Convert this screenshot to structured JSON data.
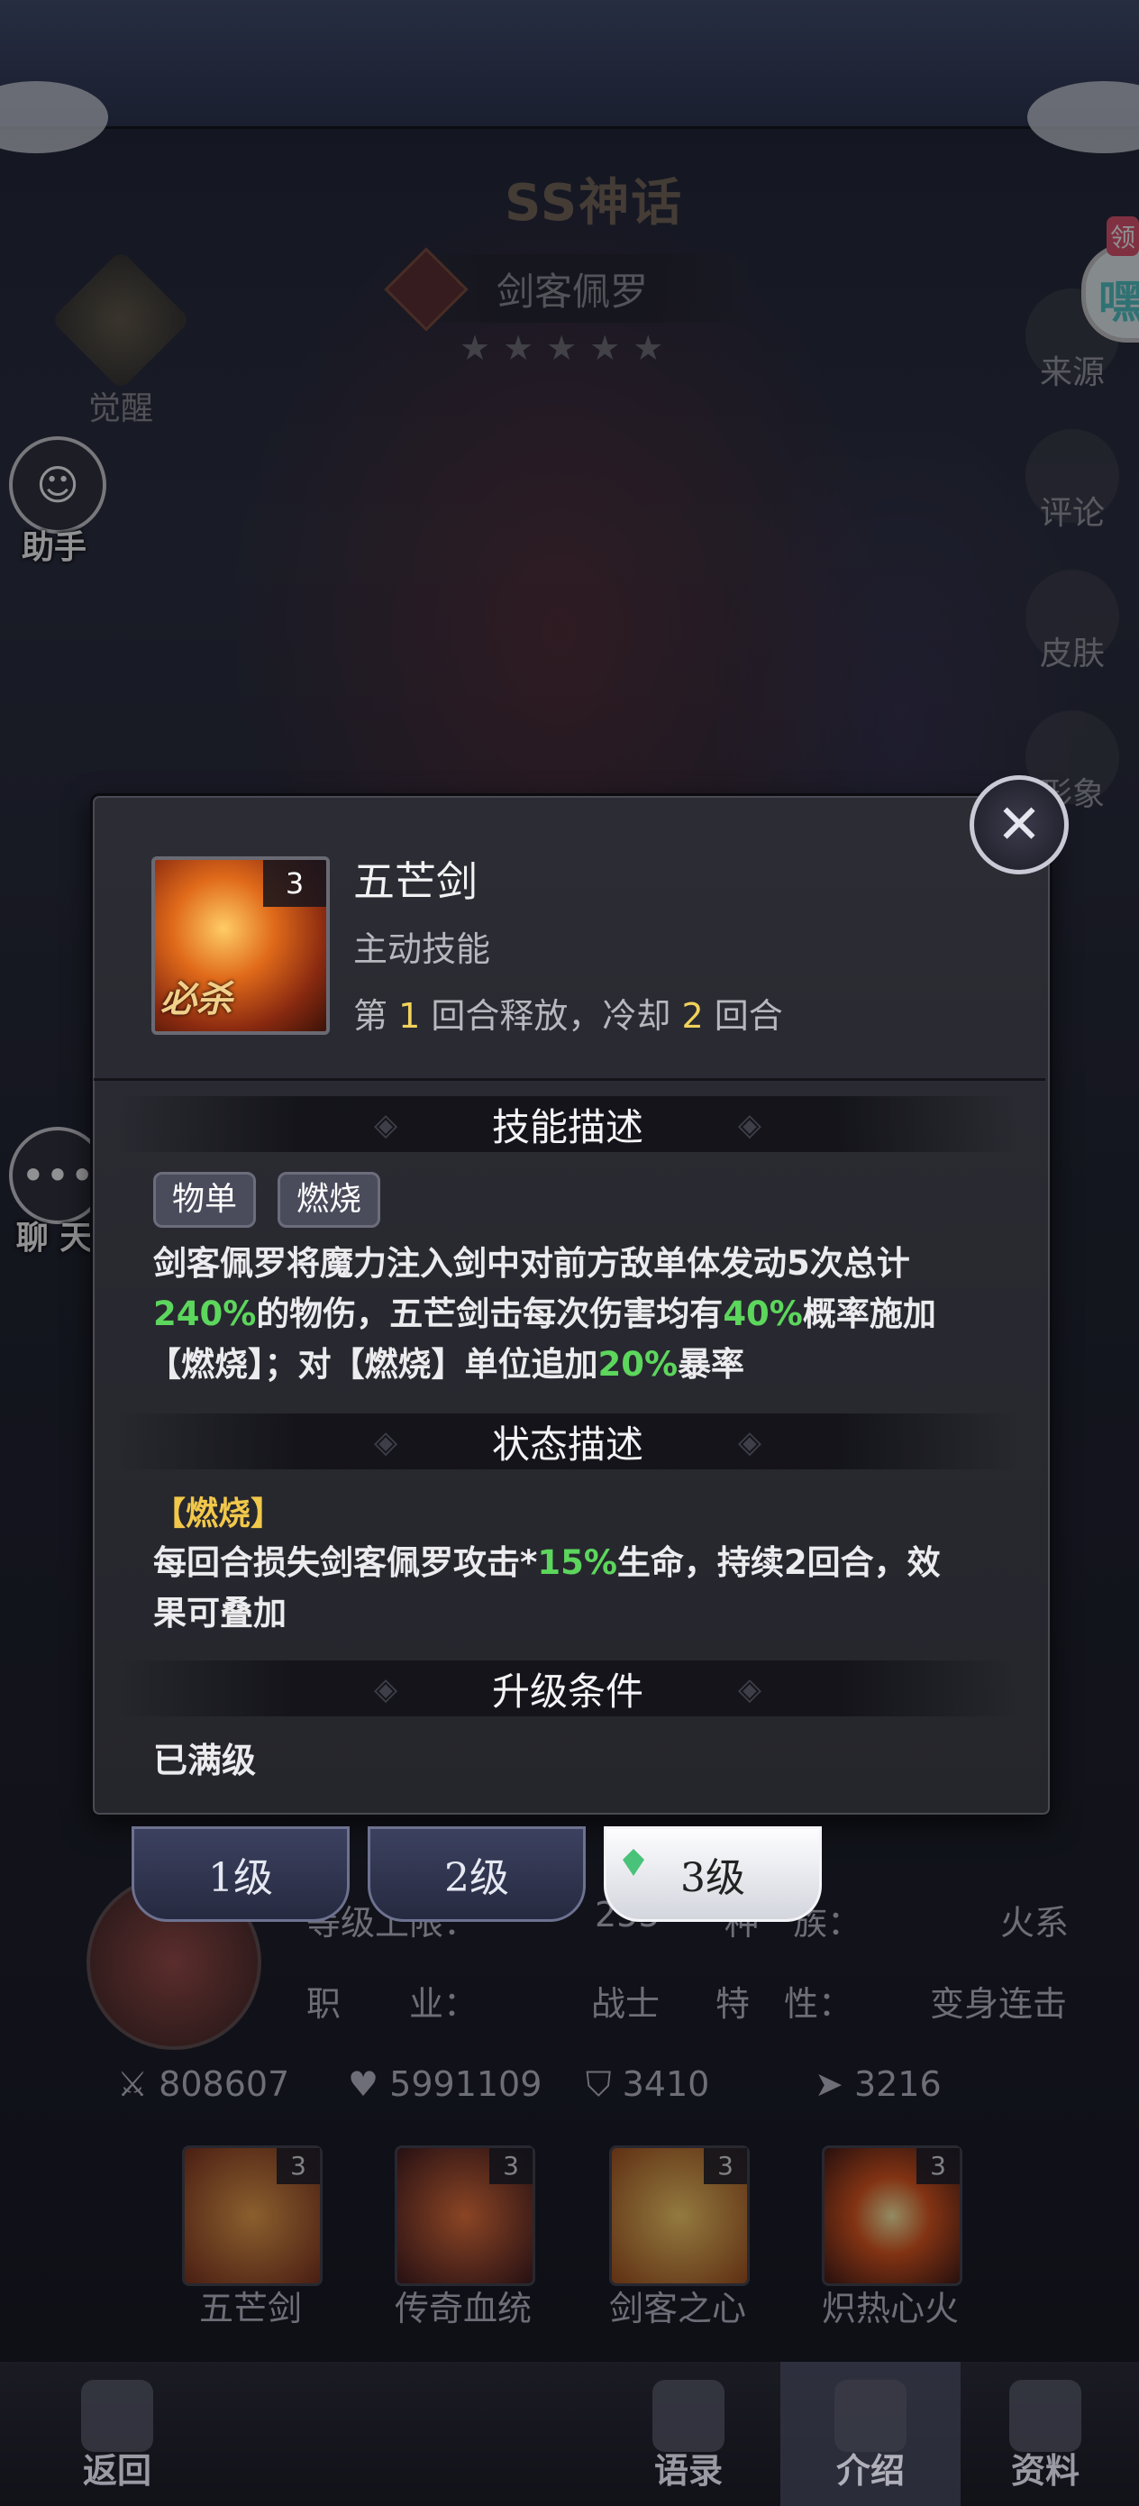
{
  "hero": {
    "rarity": "SS神话",
    "name": "剑客佩罗",
    "stars": "★★★★★",
    "awaken_label": "觉醒"
  },
  "left_buttons": {
    "assistant": "助手",
    "chat": "聊 天"
  },
  "right_buttons": {
    "source": "来源",
    "comment": "评论",
    "skin": "皮肤",
    "image": "形象",
    "bubble_tag": "领",
    "bubble_text": "嘿"
  },
  "dialog": {
    "close_symbol": "✕",
    "skill_icon_level": "3",
    "skill_icon_tag": "必杀",
    "skill_name": "五芒剑",
    "skill_type": "主动技能",
    "cooldown": {
      "p1": "第 ",
      "n1": "1",
      "p2": " 回合释放，冷却 ",
      "n2": "2",
      "p3": " 回合"
    },
    "section_desc": "技能描述",
    "tags": [
      "物单",
      "燃烧"
    ],
    "desc": {
      "line1": "剑客佩罗将魔力注入剑中对前方敌单体发动5次总计",
      "v1": "240%",
      "t2": "的物伤，五芒剑击每次伤害均有",
      "v2": "40%",
      "t3": "概率施加",
      "t4": "【燃烧】；对【燃烧】单位追加",
      "v3": "20%",
      "t5": "暴率"
    },
    "section_state": "状态描述",
    "burn_title": "【燃烧】",
    "state": {
      "t1": "每回合损失剑客佩罗攻击*",
      "v1": "15%",
      "t2": "生命，持续2回合，效",
      "t3": "果可叠加"
    },
    "section_upgrade": "升级条件",
    "upgrade_text": "已满级"
  },
  "level_tabs": [
    "1级",
    "2级",
    "3级"
  ],
  "active_level_index": 2,
  "info": {
    "cap_label": "等级上限：",
    "cap_value": "255",
    "race_label": "种　族：",
    "race_value": "火系",
    "job_label": "职　　业：",
    "job_value": "战士",
    "trait_label": "特　性：",
    "trait_value": "变身连击"
  },
  "stats": {
    "attack": "808607",
    "hp": "5991109",
    "defense": "3410",
    "speed": "3216"
  },
  "skills": [
    {
      "name": "五芒剑",
      "level": "3"
    },
    {
      "name": "传奇血统",
      "level": "3"
    },
    {
      "name": "剑客之心",
      "level": "3"
    },
    {
      "name": "炽热心火",
      "level": "3"
    }
  ],
  "nav": {
    "back": "返回",
    "quotes": "语录",
    "intro": "介绍",
    "data": "资料"
  },
  "colors": {
    "highlight_green": "#5cd65c",
    "highlight_yellow": "#f1d25a",
    "burn_gold": "#f1c84a"
  }
}
